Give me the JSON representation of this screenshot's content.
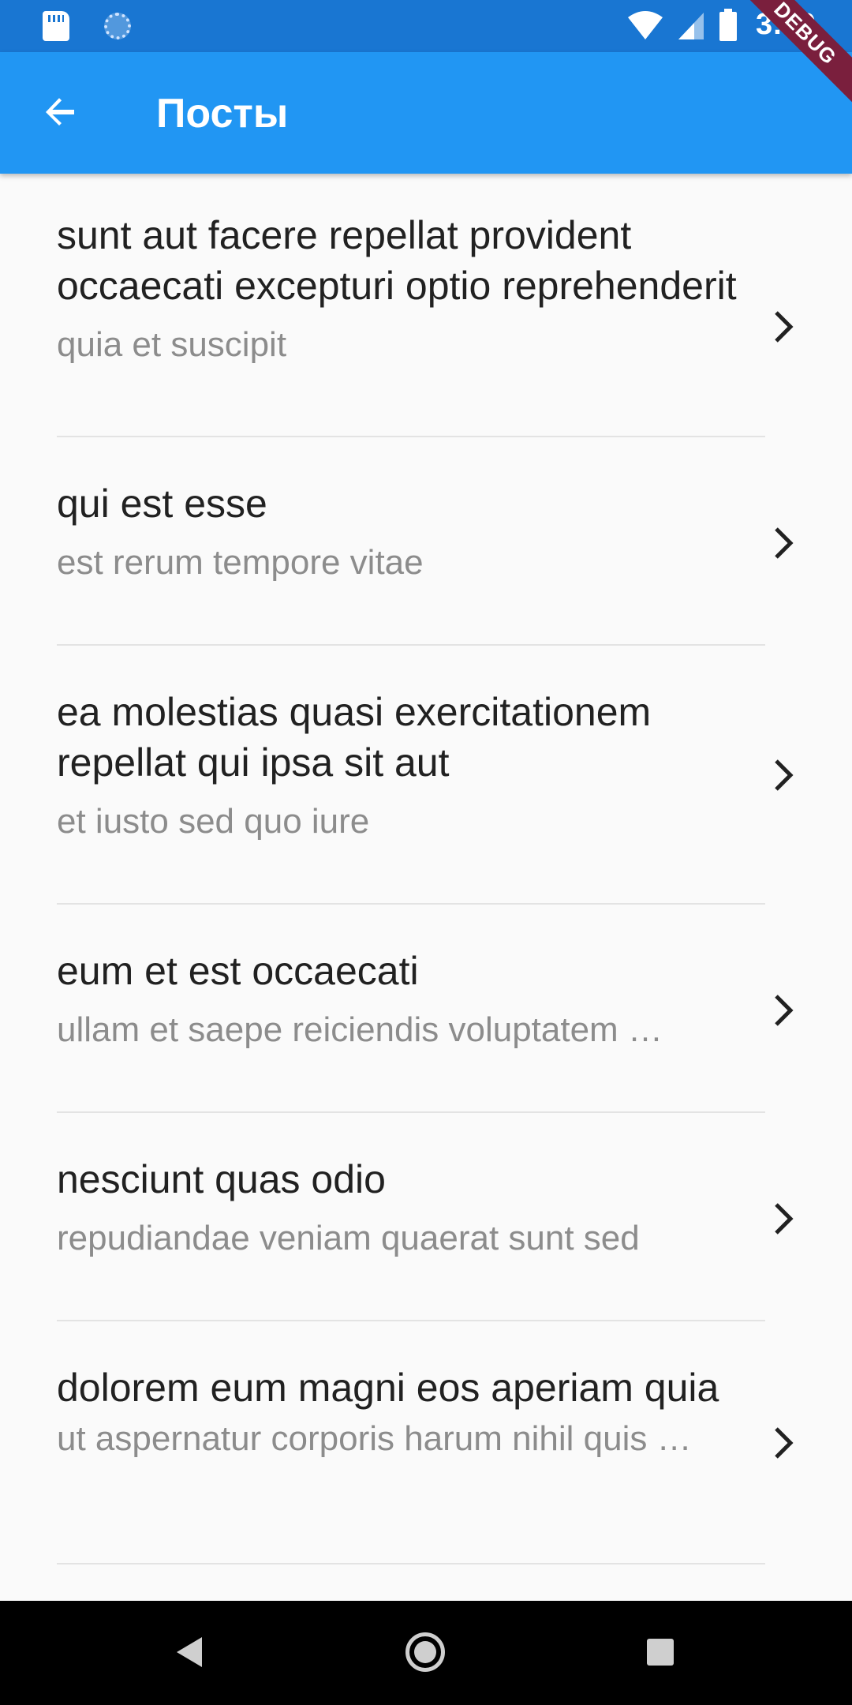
{
  "status_bar": {
    "time": "3:50",
    "icons": [
      "sd-card-icon",
      "sync-icon",
      "wifi-icon",
      "signal-icon",
      "battery-icon"
    ]
  },
  "app_bar": {
    "title": "Посты",
    "back_icon": "arrow-back-icon",
    "debug_banner": "DEBUG",
    "color": "#2196f3"
  },
  "posts": [
    {
      "title": "sunt aut facere repellat provident occaecati excepturi optio reprehenderit",
      "subtitle": "quia et suscipit"
    },
    {
      "title": "qui est esse",
      "subtitle": "est rerum tempore vitae"
    },
    {
      "title": "ea molestias quasi exercitationem repellat qui ipsa sit aut",
      "subtitle": "et iusto sed quo iure"
    },
    {
      "title": "eum et est occaecati",
      "subtitle": "ullam et saepe reiciendis voluptatem …"
    },
    {
      "title": "nesciunt quas odio",
      "subtitle": "repudiandae veniam quaerat sunt sed"
    },
    {
      "title": "dolorem eum magni eos aperiam quia",
      "subtitle": "ut aspernatur corporis harum nihil quis …"
    }
  ],
  "nav_bar": {
    "icons": [
      "nav-back-icon",
      "nav-home-icon",
      "nav-recents-icon"
    ]
  }
}
